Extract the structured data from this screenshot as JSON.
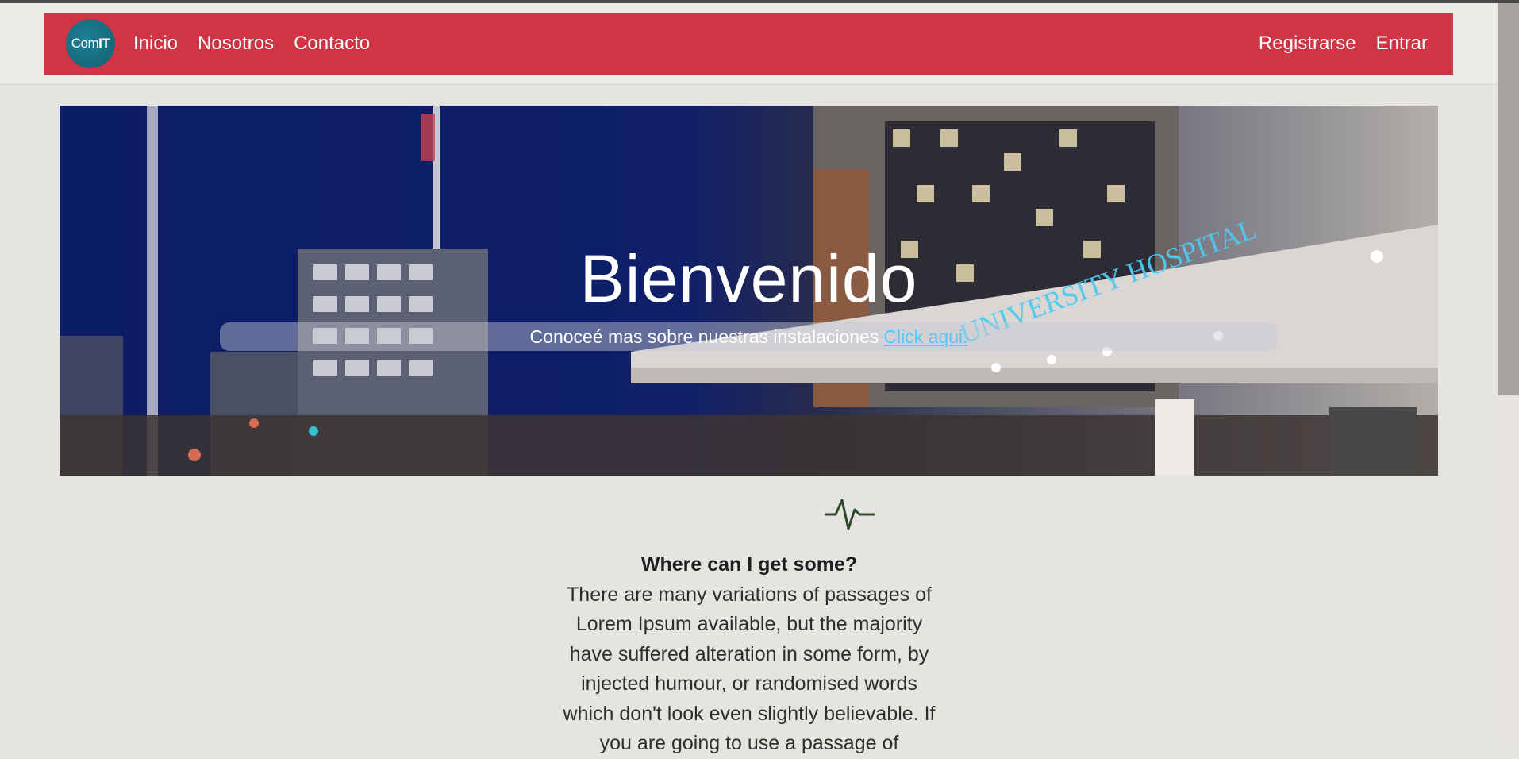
{
  "navbar": {
    "logo_text": "ComIT",
    "left_links": [
      "Inicio",
      "Nosotros",
      "Contacto"
    ],
    "right_links": [
      "Registrarse",
      "Entrar"
    ],
    "color": "#cf3545"
  },
  "hero": {
    "title": "Bienvenido",
    "subtitle": "Conoceé mas sobre nuestras instalaciones",
    "link": "Click aqui.",
    "sign_text": "UNIVERSITY HOSPITAL"
  },
  "content": {
    "icon": "heartbeat-icon",
    "heading": "Where can I get some?",
    "body": "There are many variations of passages of Lorem Ipsum available, but the majority have suffered alteration in some form, by injected humour, or randomised words which don't look even slightly believable. If you are going to use a passage of"
  }
}
